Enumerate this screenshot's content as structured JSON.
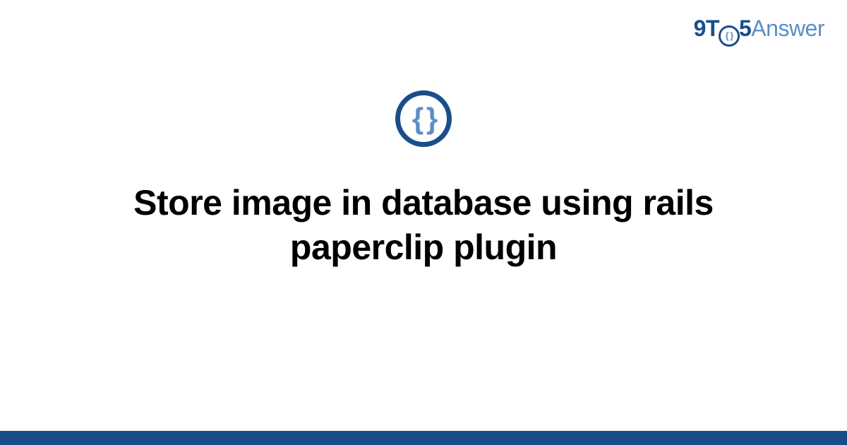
{
  "brand": {
    "part1": "9T",
    "o_inner": "{ }",
    "part2": "5",
    "part3": "Answer"
  },
  "badge": {
    "glyph": "{ }"
  },
  "title": "Store image in database using rails paperclip plugin",
  "colors": {
    "primary": "#1a4e8a",
    "accent": "#5a8fc7"
  }
}
